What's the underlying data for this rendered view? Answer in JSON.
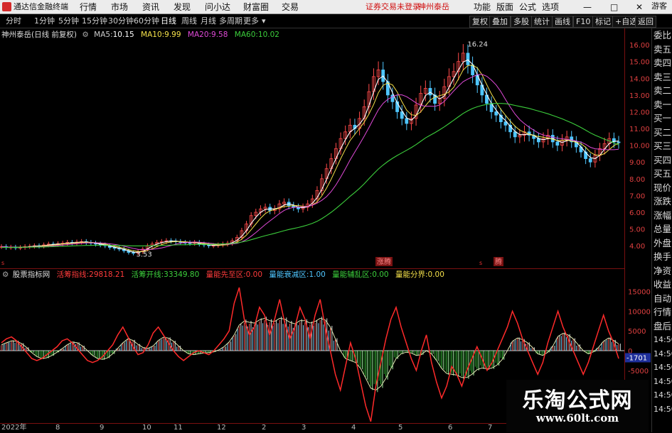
{
  "menu": {
    "app_title": "通达信金融终端",
    "items": [
      "行情",
      "市场",
      "资讯",
      "发现",
      "问小达",
      "财富圈",
      "交易"
    ],
    "warning": "证券交易未登录",
    "stock_name": "神州泰岳",
    "right_items": [
      "功能",
      "版面",
      "公式",
      "选项"
    ],
    "window_buttons": [
      "—",
      "□",
      "✕"
    ]
  },
  "toolbar": {
    "periods": [
      "分时",
      "1分钟",
      "5分钟",
      "15分钟",
      "30分钟",
      "60分钟",
      "日线",
      "周线",
      "月线",
      "多周期",
      "更多"
    ],
    "active_period": "日线",
    "right_buttons": [
      "复权",
      "叠加",
      "多股",
      "统计",
      "画线",
      "F10",
      "标记",
      "+自选",
      "返回"
    ]
  },
  "main_info": {
    "title": "神州泰岳(日线 前复权)",
    "ma": [
      {
        "label": "MA5:",
        "value": "10.15",
        "color": "#ffffff"
      },
      {
        "label": "MA10:",
        "value": "9.99",
        "color": "#f5e14a"
      },
      {
        "label": "MA20:",
        "value": "9.58",
        "color": "#e04ad8"
      },
      {
        "label": "MA60:",
        "value": "10.02",
        "color": "#3ccf3c"
      }
    ]
  },
  "indicator_info": {
    "name": "股票指标网",
    "fields": [
      {
        "label": "活筹指线:",
        "value": "29818.21",
        "color": "#ff3b3b"
      },
      {
        "label": "活筹开线:",
        "value": "33349.80",
        "color": "#3ccf3c"
      },
      {
        "label": "量能先至区:",
        "value": "0.00",
        "color": "#ff3b3b"
      },
      {
        "label": "量能衰减区:",
        "value": "1.00",
        "color": "#4fc6ff"
      },
      {
        "label": "量能辅乱区:",
        "value": "0.00",
        "color": "#3ccf3c"
      },
      {
        "label": "量能分界:",
        "value": "0.00",
        "color": "#f5e14a"
      }
    ]
  },
  "price_axis": [
    "16.00",
    "15.00",
    "14.00",
    "13.00",
    "12.00",
    "11.00",
    "10.00",
    "9.00",
    "8.00",
    "7.00",
    "6.00",
    "5.00",
    "4.00"
  ],
  "indicator_axis": [
    "15000",
    "10000",
    "5000",
    "0",
    "-1701",
    "-5000"
  ],
  "current_indicator_value": "-1701",
  "chart_annotations": {
    "high": "16.24",
    "low": "3.53",
    "tag_1": "涨腾",
    "tag_2": "腾"
  },
  "side_panel": {
    "items": [
      "委比",
      "卖五",
      "卖四",
      "卖三",
      "卖二",
      "卖一",
      "买一",
      "买二",
      "买三",
      "买四",
      "买五",
      "现价",
      "涨跌",
      "涨幅",
      "总量",
      "外盘",
      "换手",
      "净资",
      "收益",
      "自动",
      "行情",
      "盘后",
      "14:50",
      "14:50",
      "14:50",
      "14:50",
      "14:50",
      "14:50"
    ],
    "top_label": "游客"
  },
  "date_axis": [
    "2022年",
    "8",
    "9",
    "10",
    "11",
    "12",
    "2",
    "3",
    "4",
    "5",
    "6",
    "7"
  ],
  "watermark": {
    "main": "乐淘公式网",
    "url": "www.60lt.com"
  },
  "chart_data": {
    "type": "line",
    "price_ylim": [
      3.5,
      16.3
    ],
    "price_ticks": [
      4,
      5,
      6,
      7,
      8,
      9,
      10,
      11,
      12,
      13,
      14,
      15,
      16
    ],
    "close": [
      3.95,
      3.9,
      3.92,
      3.88,
      3.9,
      3.95,
      3.97,
      4.0,
      3.98,
      4.05,
      4.1,
      4.08,
      4.12,
      4.15,
      4.2,
      4.18,
      4.22,
      4.25,
      4.2,
      4.15,
      4.1,
      4.05,
      4.0,
      3.9,
      3.85,
      3.8,
      3.7,
      3.6,
      3.55,
      3.65,
      3.8,
      4.0,
      4.1,
      4.2,
      4.25,
      4.3,
      4.28,
      4.25,
      4.2,
      4.18,
      4.15,
      4.2,
      4.1,
      4.05,
      4.0,
      4.02,
      4.05,
      4.1,
      4.15,
      4.3,
      4.5,
      4.9,
      5.3,
      5.8,
      6.0,
      6.2,
      6.3,
      6.1,
      6.2,
      6.5,
      6.6,
      6.4,
      6.3,
      6.2,
      6.3,
      6.5,
      6.8,
      7.3,
      8.0,
      8.6,
      9.2,
      9.8,
      10.4,
      10.8,
      11.2,
      11.0,
      11.6,
      12.3,
      13.2,
      14.1,
      14.5,
      13.8,
      13.0,
      12.6,
      12.0,
      11.6,
      11.3,
      11.6,
      12.4,
      13.1,
      13.4,
      13.0,
      12.5,
      12.8,
      13.5,
      14.1,
      14.4,
      15.0,
      15.5,
      14.8,
      14.2,
      13.6,
      13.0,
      12.5,
      12.0,
      11.8,
      11.4,
      11.2,
      10.8,
      10.5,
      10.6,
      10.8,
      10.6,
      10.4,
      10.2,
      10.4,
      10.6,
      10.2,
      10.0,
      10.3,
      10.5,
      10.2,
      9.9,
      9.6,
      9.2,
      9.0,
      9.4,
      9.8,
      10.1,
      10.4,
      10.2,
      10.15
    ],
    "ma60": [
      3.9,
      3.9,
      3.9,
      3.9,
      3.91,
      3.91,
      3.92,
      3.92,
      3.93,
      3.93,
      3.94,
      3.95,
      3.96,
      3.97,
      3.98,
      3.99,
      4.0,
      4.01,
      4.02,
      4.02,
      4.03,
      4.03,
      4.03,
      4.03,
      4.02,
      4.02,
      4.01,
      4.0,
      3.99,
      3.99,
      3.99,
      4.0,
      4.0,
      4.01,
      4.02,
      4.03,
      4.04,
      4.05,
      4.06,
      4.06,
      4.07,
      4.07,
      4.08,
      4.08,
      4.08,
      4.09,
      4.1,
      4.11,
      4.12,
      4.14,
      4.17,
      4.22,
      4.28,
      4.36,
      4.44,
      4.52,
      4.6,
      4.67,
      4.74,
      4.82,
      4.9,
      4.97,
      5.03,
      5.09,
      5.16,
      5.24,
      5.34,
      5.46,
      5.62,
      5.8,
      6.0,
      6.22,
      6.46,
      6.7,
      6.95,
      7.18,
      7.43,
      7.7,
      8.0,
      8.3,
      8.58,
      8.82,
      9.03,
      9.22,
      9.39,
      9.55,
      9.7,
      9.86,
      10.04,
      10.24,
      10.44,
      10.6,
      10.75,
      10.92,
      11.1,
      11.3,
      11.5,
      11.7,
      11.9,
      12.06,
      12.2,
      12.3,
      12.38,
      12.44,
      12.48,
      12.5,
      12.5,
      12.48,
      12.44,
      12.38,
      12.32,
      12.26,
      12.2,
      12.12,
      12.04,
      11.96,
      11.88,
      11.78,
      11.68,
      11.58,
      11.46,
      11.34,
      11.2,
      11.06,
      10.9,
      10.74,
      10.6,
      10.48,
      10.36,
      10.26,
      10.14,
      10.02
    ],
    "indicator_ylim": [
      -18000,
      18000
    ],
    "indicator_ticks": [
      15000,
      10000,
      5000,
      0,
      -5000
    ],
    "active_line": [
      2000,
      3000,
      3500,
      2500,
      1000,
      -500,
      -2000,
      -2500,
      -2000,
      -1000,
      0,
      1000,
      2500,
      3000,
      2000,
      500,
      -1000,
      -2500,
      -3000,
      -2500,
      -1500,
      0,
      1500,
      4000,
      6000,
      3500,
      1000,
      -1000,
      -500,
      1500,
      4500,
      6000,
      4000,
      2000,
      0,
      -1500,
      -2500,
      -1500,
      -500,
      0,
      -500,
      -1000,
      0,
      1500,
      3000,
      5000,
      12000,
      16000,
      8000,
      4000,
      6000,
      11000,
      9000,
      4000,
      8000,
      13000,
      7000,
      3000,
      6000,
      11000,
      8000,
      3000,
      9000,
      13000,
      6000,
      0,
      -6000,
      -10000,
      -4000,
      2000,
      -2000,
      -8000,
      -14000,
      -18000,
      -9000,
      -3000,
      3000,
      8000,
      11000,
      6000,
      2000,
      -2000,
      -5000,
      0,
      4000,
      -3000,
      -8000,
      -12000,
      -9000,
      -4000,
      -6000,
      -9000,
      -5000,
      -2000,
      1000,
      -2000,
      -5000,
      -3000,
      0,
      3000,
      6000,
      10000,
      7000,
      3000,
      0,
      -3000,
      -6000,
      -3000,
      2000,
      6000,
      10000,
      6000,
      3000,
      0,
      -3000,
      -6000,
      -3000,
      1000,
      5000,
      9000,
      5000,
      2000,
      -2000
    ],
    "bar_line": [
      1500,
      2000,
      2500,
      2400,
      1800,
      800,
      -500,
      -1500,
      -2000,
      -1800,
      -1200,
      -400,
      500,
      1500,
      2200,
      2000,
      1200,
      0,
      -1200,
      -2000,
      -2200,
      -1800,
      -800,
      600,
      2000,
      3000,
      2600,
      1600,
      800,
      600,
      1200,
      2600,
      3400,
      3200,
      2400,
      1200,
      0,
      -800,
      -1000,
      -800,
      -600,
      -500,
      -300,
      200,
      1000,
      2200,
      4000,
      6500,
      7500,
      7200,
      7000,
      7800,
      8200,
      7600,
      7400,
      8200,
      8000,
      7200,
      6800,
      7600,
      7600,
      7000,
      7400,
      8200,
      7800,
      6000,
      3000,
      0,
      -2000,
      -2500,
      -3000,
      -4500,
      -7000,
      -9500,
      -10000,
      -9000,
      -7000,
      -4500,
      -2000,
      -800,
      -400,
      -600,
      -1200,
      -1000,
      0,
      -800,
      -2500,
      -4500,
      -5800,
      -6000,
      -6200,
      -6800,
      -6800,
      -6000,
      -4800,
      -4400,
      -4600,
      -4400,
      -3600,
      -2200,
      0,
      2400,
      3200,
      2800,
      2000,
      800,
      -800,
      -1200,
      -400,
      1200,
      3600,
      4400,
      4000,
      3000,
      1500,
      0,
      -800,
      -300,
      800,
      2400,
      3200,
      2600,
      1701
    ]
  }
}
